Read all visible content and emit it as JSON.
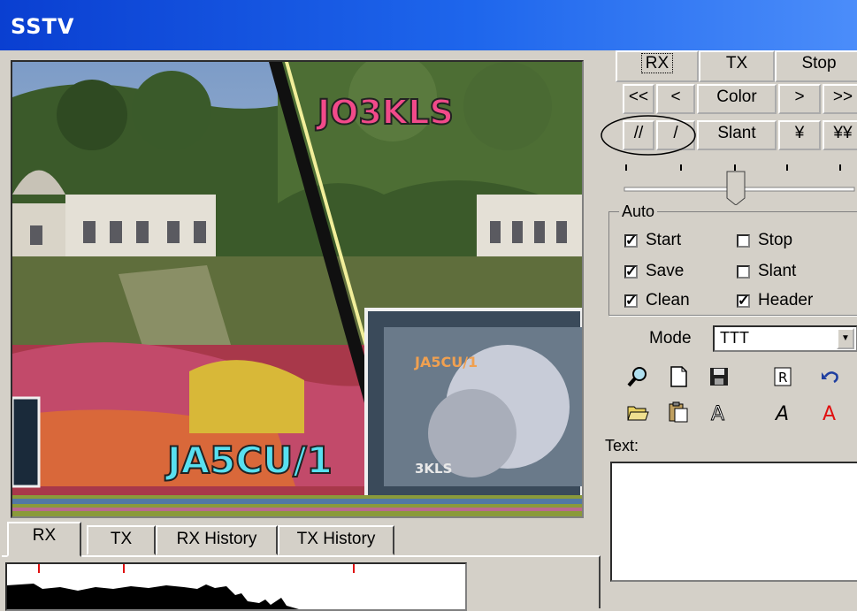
{
  "window": {
    "title": "SSTV"
  },
  "image": {
    "callsign_top": "JO3KLS",
    "callsign_bottom": "JA5CU/1",
    "inset_callsign": "JA5CU/1",
    "inset_bottom": "3KLS"
  },
  "controls": {
    "rx_label": "RX",
    "tx_label": "TX",
    "stop_label": "Stop",
    "prev2_label": "<<",
    "prev_label": "<",
    "color_label": "Color",
    "next_label": ">",
    "next2_label": ">>",
    "slash2_label": "//",
    "slash_label": "/",
    "slant_label": "Slant",
    "yen_label": "¥",
    "yen2_label": "¥¥"
  },
  "auto": {
    "title": "Auto",
    "start": {
      "label": "Start",
      "checked": true
    },
    "stop": {
      "label": "Stop",
      "checked": false
    },
    "save": {
      "label": "Save",
      "checked": true
    },
    "slant": {
      "label": "Slant",
      "checked": false
    },
    "clean": {
      "label": "Clean",
      "checked": true
    },
    "header": {
      "label": "Header",
      "checked": true
    }
  },
  "mode": {
    "label": "Mode",
    "value": "TTT"
  },
  "text_label": "Text:",
  "tabs": [
    "RX",
    "TX",
    "RX History",
    "TX History"
  ],
  "colors": {
    "titlebar": "#1e66ec",
    "face": "#d4d0c8"
  }
}
